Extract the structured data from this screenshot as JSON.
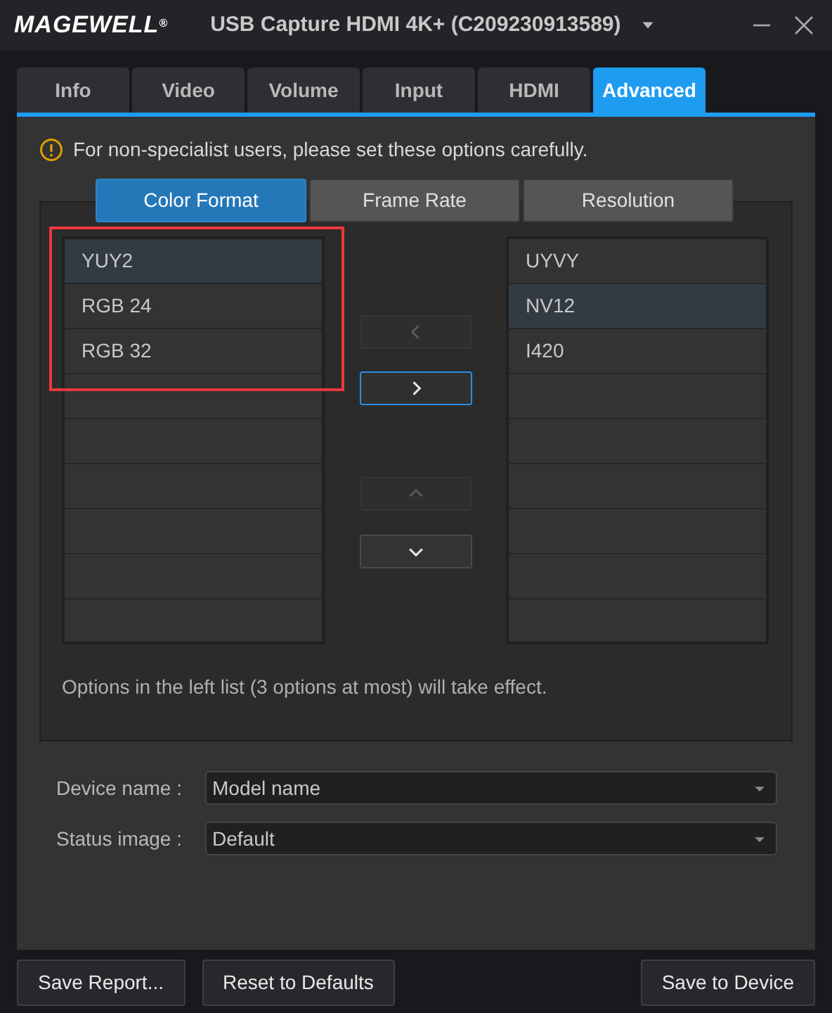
{
  "window": {
    "logo": "MAGEWELL$^{®}$",
    "title": "USB Capture HDMI 4K+ (C209230913589)"
  },
  "tabs": [
    {
      "label": "Info",
      "selected": false
    },
    {
      "label": "Video",
      "selected": false
    },
    {
      "label": "Volume",
      "selected": false
    },
    {
      "label": "Input",
      "selected": false
    },
    {
      "label": "HDMI",
      "selected": false
    },
    {
      "label": "Advanced",
      "selected": true
    }
  ],
  "warning": "For non-specialist users, please set these options carefully.",
  "subtabs": [
    {
      "label": "Color Format",
      "selected": true
    },
    {
      "label": "Frame Rate",
      "selected": false
    },
    {
      "label": "Resolution",
      "selected": false
    }
  ],
  "left_list": [
    {
      "label": "YUY2",
      "selected": true
    },
    {
      "label": "RGB 24",
      "selected": false
    },
    {
      "label": "RGB 32",
      "selected": false
    }
  ],
  "right_list": [
    {
      "label": "UYVY",
      "selected": false
    },
    {
      "label": "NV12",
      "selected": true
    },
    {
      "label": "I420",
      "selected": false
    }
  ],
  "move_buttons": [
    {
      "kind": "left",
      "disabled": true,
      "focused": false
    },
    {
      "kind": "right",
      "disabled": false,
      "focused": true
    },
    {
      "kind": "up",
      "disabled": true,
      "focused": false
    },
    {
      "kind": "down",
      "disabled": false,
      "focused": false
    }
  ],
  "note": "Options in the left list (3 options at most) will take effect.",
  "fields": [
    {
      "label": "Device name :",
      "value": "Model name"
    },
    {
      "label": "Status image :",
      "value": "Default"
    }
  ],
  "buttons": [
    "Save Report...",
    "Reset to Defaults",
    "Save to Device"
  ]
}
